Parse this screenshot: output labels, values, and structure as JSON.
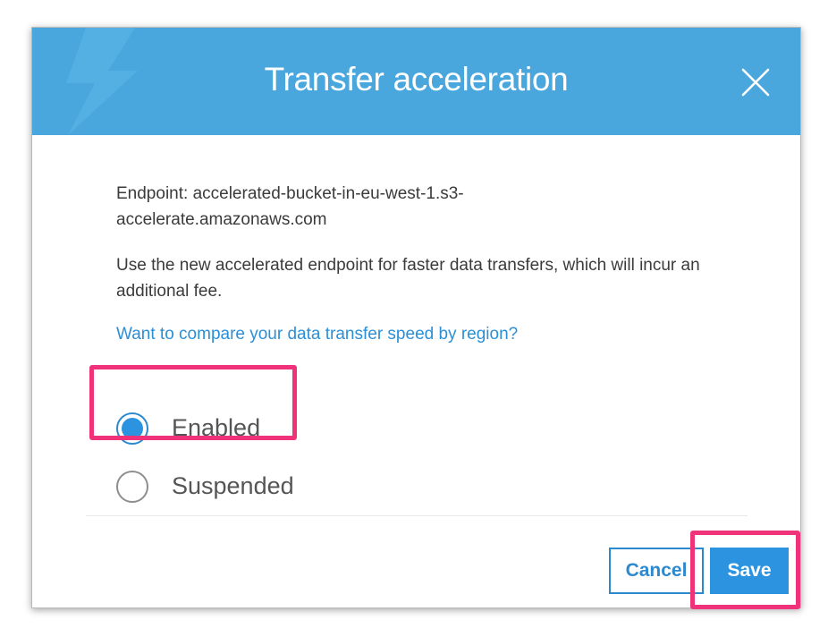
{
  "dialog": {
    "title": "Transfer acceleration",
    "close_icon": "close-icon",
    "header_color": "#4aa7dd"
  },
  "body": {
    "endpoint_line1": "Endpoint: accelerated-bucket-in-eu-west-1.s3-",
    "endpoint_line2": "accelerate.amazonaws.com",
    "description": "Use the new accelerated endpoint for faster data transfers, which will incur an additional fee.",
    "compare_link": "Want to compare your data transfer speed by region?"
  },
  "options": {
    "enabled_label": "Enabled",
    "suspended_label": "Suspended",
    "selected": "Enabled"
  },
  "footer": {
    "cancel_label": "Cancel",
    "save_label": "Save"
  },
  "colors": {
    "accent": "#2b93e0",
    "highlight": "#f0327a",
    "link": "#2b8fd6"
  }
}
